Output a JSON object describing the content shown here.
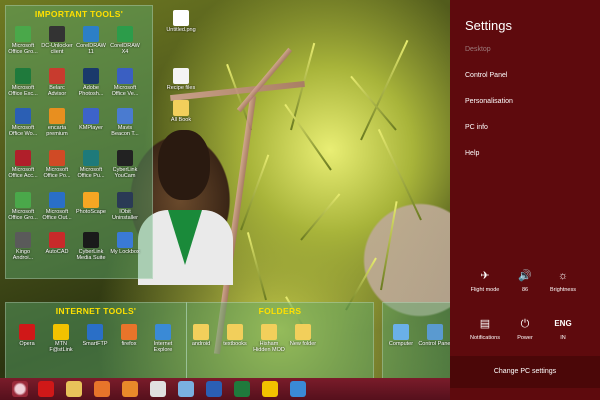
{
  "desktop": {
    "important_group_title": "IMPORTANT TOOLS'",
    "internet_group_title": "INTERNET TOOLS'",
    "folders_group_title": "FOLDERS",
    "loose_icons": [
      {
        "label": "Untitled.png",
        "color": "#ffffff"
      },
      {
        "label": "Recipe files",
        "color": "#f4f4f4"
      },
      {
        "label": "All Book",
        "color": "#f2cf5b"
      }
    ],
    "important_icons": [
      {
        "label": "Microsoft Office Gro...",
        "color": "#4aa84a"
      },
      {
        "label": "DC-Unlocker client",
        "color": "#333333"
      },
      {
        "label": "CorelDRAW 11",
        "color": "#2c7fc7"
      },
      {
        "label": "CorelDRAW X4",
        "color": "#2c9c4a"
      },
      {
        "label": "Microsoft Office Exc...",
        "color": "#1f7a3c"
      },
      {
        "label": "Belarc Advisor",
        "color": "#c83b2e"
      },
      {
        "label": "Adobe Photosh...",
        "color": "#1a3a6b"
      },
      {
        "label": "Microsoft Office Ve...",
        "color": "#3a5fc2"
      },
      {
        "label": "Microsoft Office Wo...",
        "color": "#2b5fb4"
      },
      {
        "label": "encarta premium",
        "color": "#e88f1f"
      },
      {
        "label": "KMPlayer",
        "color": "#3d63c9"
      },
      {
        "label": "Mavis Beacon T...",
        "color": "#4a7bd0"
      },
      {
        "label": "Microsoft Office Acc...",
        "color": "#b01f2a"
      },
      {
        "label": "Microsoft Office Po...",
        "color": "#d04a25"
      },
      {
        "label": "Microsoft Office Pu...",
        "color": "#1e7a7a"
      },
      {
        "label": "CyberLink YouCam",
        "color": "#222222"
      },
      {
        "label": "Microsoft Office Gro...",
        "color": "#4aa84a"
      },
      {
        "label": "Microsoft Office Out...",
        "color": "#2a6fc7"
      },
      {
        "label": "PhotoScape",
        "color": "#f5a623"
      },
      {
        "label": "IObit Uninstaller",
        "color": "#2a3a55"
      },
      {
        "label": "Kingo Androi...",
        "color": "#5a5a5a"
      },
      {
        "label": "AutoCAD",
        "color": "#c82a2a"
      },
      {
        "label": "CyberLink Media Suite",
        "color": "#1a1a1a"
      },
      {
        "label": "My Lockbox",
        "color": "#3a7ad6"
      }
    ],
    "internet_icons": [
      {
        "label": "Opera",
        "color": "#d01818"
      },
      {
        "label": "MTN F@stLink",
        "color": "#f2c200"
      },
      {
        "label": "SmartFTP",
        "color": "#2a6fc7"
      },
      {
        "label": "firefox",
        "color": "#e8742a"
      },
      {
        "label": "Internet Explore",
        "color": "#3a8ad6"
      }
    ],
    "folder_icons": [
      {
        "label": "android",
        "color": "#f2cf5b"
      },
      {
        "label": "textbooks",
        "color": "#f2cf5b"
      },
      {
        "label": "Hisham Hidden MOD",
        "color": "#f2cf5b"
      },
      {
        "label": "New folder",
        "color": "#f2cf5b"
      }
    ],
    "right_group_icons": [
      {
        "label": "Computer",
        "color": "#6ab0e8"
      },
      {
        "label": "Control Panel",
        "color": "#5a9ad0"
      }
    ]
  },
  "taskbar": {
    "items": [
      {
        "name": "opera-icon",
        "color": "#d01818"
      },
      {
        "name": "explorer-icon",
        "color": "#e8c25a"
      },
      {
        "name": "media-player-icon",
        "color": "#e8742a"
      },
      {
        "name": "firefox-icon",
        "color": "#e88a2a"
      },
      {
        "name": "chrome-icon",
        "color": "#e0e0e0"
      },
      {
        "name": "notepad-icon",
        "color": "#7ab0e0"
      },
      {
        "name": "word-icon",
        "color": "#2b5fb4"
      },
      {
        "name": "excel-icon",
        "color": "#1f7a3c"
      },
      {
        "name": "paint-icon",
        "color": "#f2c200"
      },
      {
        "name": "utility-icon",
        "color": "#3a8ad6"
      }
    ]
  },
  "charm": {
    "title": "Settings",
    "menu": [
      "Desktop",
      "Control Panel",
      "Personalisation",
      "PC info",
      "Help"
    ],
    "tiles_row1": [
      {
        "icon": "✈",
        "label": "Flight mode"
      },
      {
        "icon": "🔊",
        "label": "86"
      },
      {
        "icon": "☼",
        "label": "Brightness"
      }
    ],
    "tiles_row2": [
      {
        "icon": "▤",
        "label": "Notifications"
      },
      {
        "icon": "⏻",
        "label": "Power"
      },
      {
        "icon": "ENG",
        "label": "IN"
      }
    ],
    "change_settings": "Change PC settings",
    "accent_color": "#5e0a0d"
  }
}
